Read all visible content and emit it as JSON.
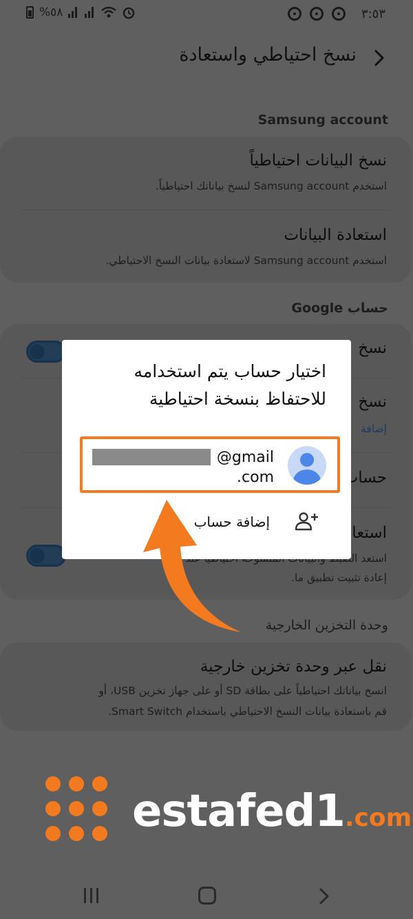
{
  "status_bar": {
    "time": "٣:٥٣",
    "battery": "%٥٨"
  },
  "header": {
    "title": "نسخ احتياطي واستعادة"
  },
  "samsung_section": {
    "label": "Samsung account",
    "items": [
      {
        "title": "نسخ البيانات احتياطياً",
        "subtitle": "استخدم Samsung account لنسخ بياناتك احتياطياً."
      },
      {
        "title": "استعادة البيانات",
        "subtitle": "استخدم Samsung account لاستعادة بيانات النسخ الاحتياطي."
      }
    ]
  },
  "google_section": {
    "label": "حساب Google",
    "items": [
      {
        "title": "نسخ"
      },
      {
        "title": "نسخ",
        "subtitle": "إضافة"
      },
      {
        "title": "حساب"
      },
      {
        "title": "استعادة",
        "subtitle_line1": "استعد الضبط والبيانات المنسوخة احتياطياً عند",
        "subtitle_line2": "إعادة تثبيت تطبيق ما."
      }
    ]
  },
  "external_section": {
    "label": "وحدة التخزين الخارجية",
    "item": {
      "title": "نقل عبر وحدة تخزين خارجية",
      "subtitle_line1": "انسخ بياناتك احتياطياً على بطاقة SD أو على جهاز تخزين USB، أو",
      "subtitle_line2": "قم باستعادة بيانات النسخ الاحتياطي باستخدام Smart Switch."
    }
  },
  "dialog": {
    "title": "اختيار حساب يتم استخدامه للاحتفاظ بنسخة احتياطية",
    "account_email_line1": "@gmail",
    "account_email_line2": ".com",
    "add_account_label": "إضافة حساب"
  },
  "logo": {
    "name": "estafed1",
    "domain": ".com"
  },
  "colors": {
    "highlight": "#f37a1f",
    "toggle_on": "#16324d",
    "dim_background": "#5f5f5f"
  }
}
